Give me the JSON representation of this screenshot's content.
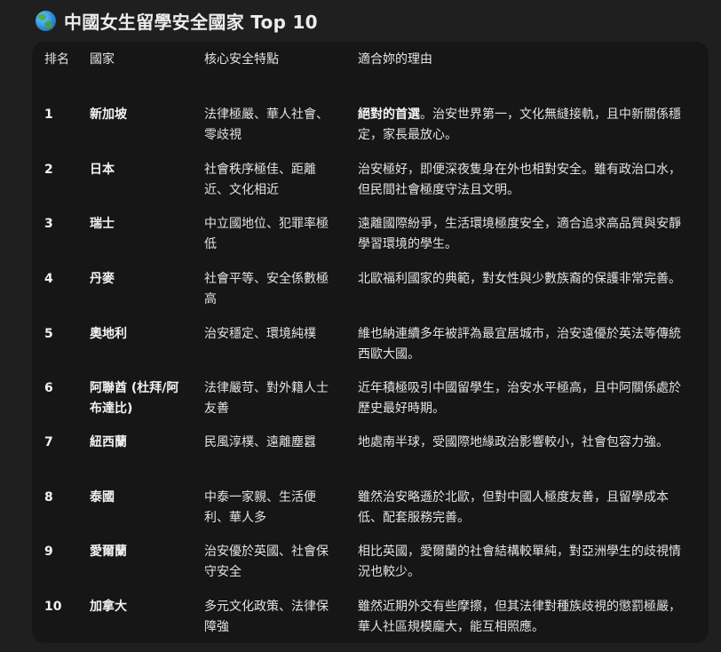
{
  "heading": {
    "icon": "globe-icon",
    "title": "中國女生留學安全國家 Top 10"
  },
  "table": {
    "headers": {
      "rank": "排名",
      "country": "國家",
      "feature": "核心安全特點",
      "reason": "適合妳的理由"
    },
    "rows": [
      {
        "rank": "1",
        "country": "新加坡",
        "feature": "法律極嚴、華人社會、零歧視",
        "reason_lead": "絕對的首選",
        "reason": "。治安世界第一，文化無縫接軌，且中新關係穩定，家長最放心。"
      },
      {
        "rank": "2",
        "country": "日本",
        "feature": "社會秩序極佳、距離近、文化相近",
        "reason_lead": "",
        "reason": "治安極好，即便深夜隻身在外也相對安全。雖有政治口水，但民間社會極度守法且文明。"
      },
      {
        "rank": "3",
        "country": "瑞士",
        "feature": "中立國地位、犯罪率極低",
        "reason_lead": "",
        "reason": "遠離國際紛爭，生活環境極度安全，適合追求高品質與安靜學習環境的學生。"
      },
      {
        "rank": "4",
        "country": "丹麥",
        "feature": "社會平等、安全係數極高",
        "reason_lead": "",
        "reason": "北歐福利國家的典範，對女性與少數族裔的保護非常完善。"
      },
      {
        "rank": "5",
        "country": "奧地利",
        "feature": "治安穩定、環境純樸",
        "reason_lead": "",
        "reason": "維也納連續多年被評為最宜居城市，治安遠優於英法等傳統西歐大國。"
      },
      {
        "rank": "6",
        "country": "阿聯酋 (杜拜/阿布達比)",
        "feature": "法律嚴苛、對外籍人士友善",
        "reason_lead": "",
        "reason": "近年積極吸引中國留學生，治安水平極高，且中阿關係處於歷史最好時期。"
      },
      {
        "rank": "7",
        "country": "紐西蘭",
        "feature": "民風淳樸、遠離塵囂",
        "reason_lead": "",
        "reason": "地處南半球，受國際地緣政治影響較小，社會包容力強。"
      },
      {
        "rank": "8",
        "country": "泰國",
        "feature": "中泰一家親、生活便利、華人多",
        "reason_lead": "",
        "reason": "雖然治安略遜於北歐，但對中國人極度友善，且留學成本低、配套服務完善。"
      },
      {
        "rank": "9",
        "country": "愛爾蘭",
        "feature": "治安優於英國、社會保守安全",
        "reason_lead": "",
        "reason": "相比英國，愛爾蘭的社會結構較單純，對亞洲學生的歧視情況也較少。"
      },
      {
        "rank": "10",
        "country": "加拿大",
        "feature": "多元文化政策、法律保障強",
        "reason_lead": "",
        "reason": "雖然近期外交有些摩擦，但其法律對種族歧視的懲罰極嚴，華人社區規模龐大，能互相照應。"
      }
    ]
  }
}
